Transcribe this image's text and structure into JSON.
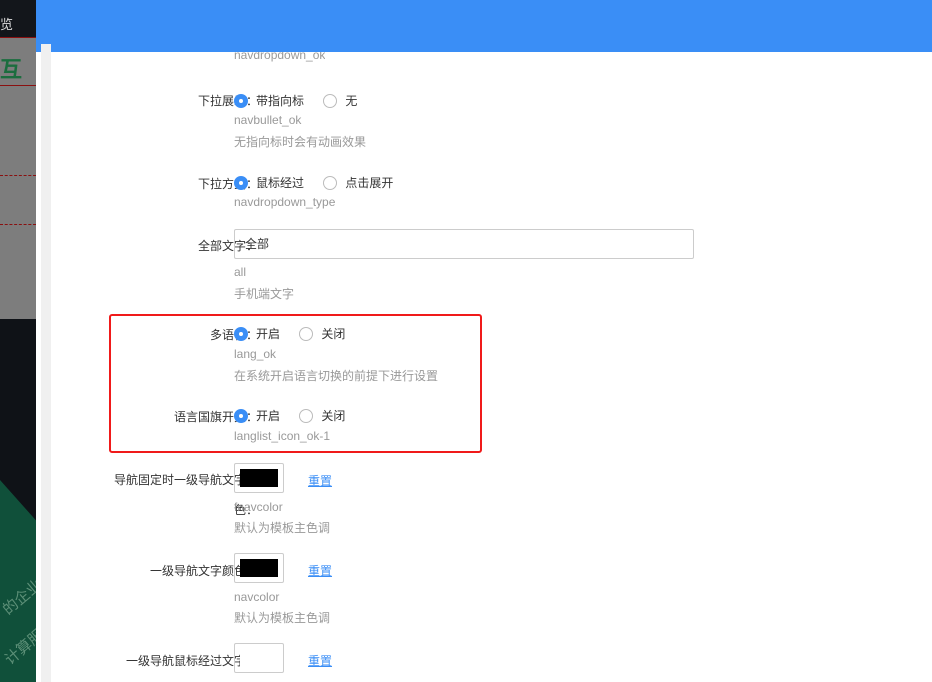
{
  "background": {
    "top_char": "览",
    "logo_char": "互",
    "slogan1": "的企业",
    "slogan2": "计算服"
  },
  "fields": [
    {
      "hint_top": "navdropdown_ok"
    },
    {
      "label": "下拉展示：",
      "options": [
        "带指向标",
        "无"
      ],
      "selected": 0,
      "key": "navbullet_ok",
      "desc": "无指向标时会有动画效果"
    },
    {
      "label": "下拉方式：",
      "options": [
        "鼠标经过",
        "点击展开"
      ],
      "selected": 0,
      "key": "navdropdown_type"
    },
    {
      "label": "全部文字：",
      "value": "全部",
      "key": "all",
      "desc": "手机端文字"
    },
    {
      "label": "多语言：",
      "options": [
        "开启",
        "关闭"
      ],
      "selected": 0,
      "key": "lang_ok",
      "desc": "在系统开启语言切换的前提下进行设置"
    },
    {
      "label": "语言国旗开关：",
      "options": [
        "开启",
        "关闭"
      ],
      "selected": 0,
      "key": "langlist_icon_ok-1"
    },
    {
      "label": "导航固定时一级导航文字颜",
      "label2": "色：",
      "color": "#000000",
      "reset": "重置",
      "key": "fnavcolor",
      "desc": "默认为模板主色调"
    },
    {
      "label": "一级导航文字颜色：",
      "color": "#000000",
      "reset": "重置",
      "key": "navcolor",
      "desc": "默认为模板主色调"
    },
    {
      "label": "一级导航鼠标经过文字颜",
      "color": "#ffffff",
      "reset": "重置"
    }
  ],
  "colors": {
    "accent": "#3a8ef6",
    "highlight": "#f01a1a"
  }
}
